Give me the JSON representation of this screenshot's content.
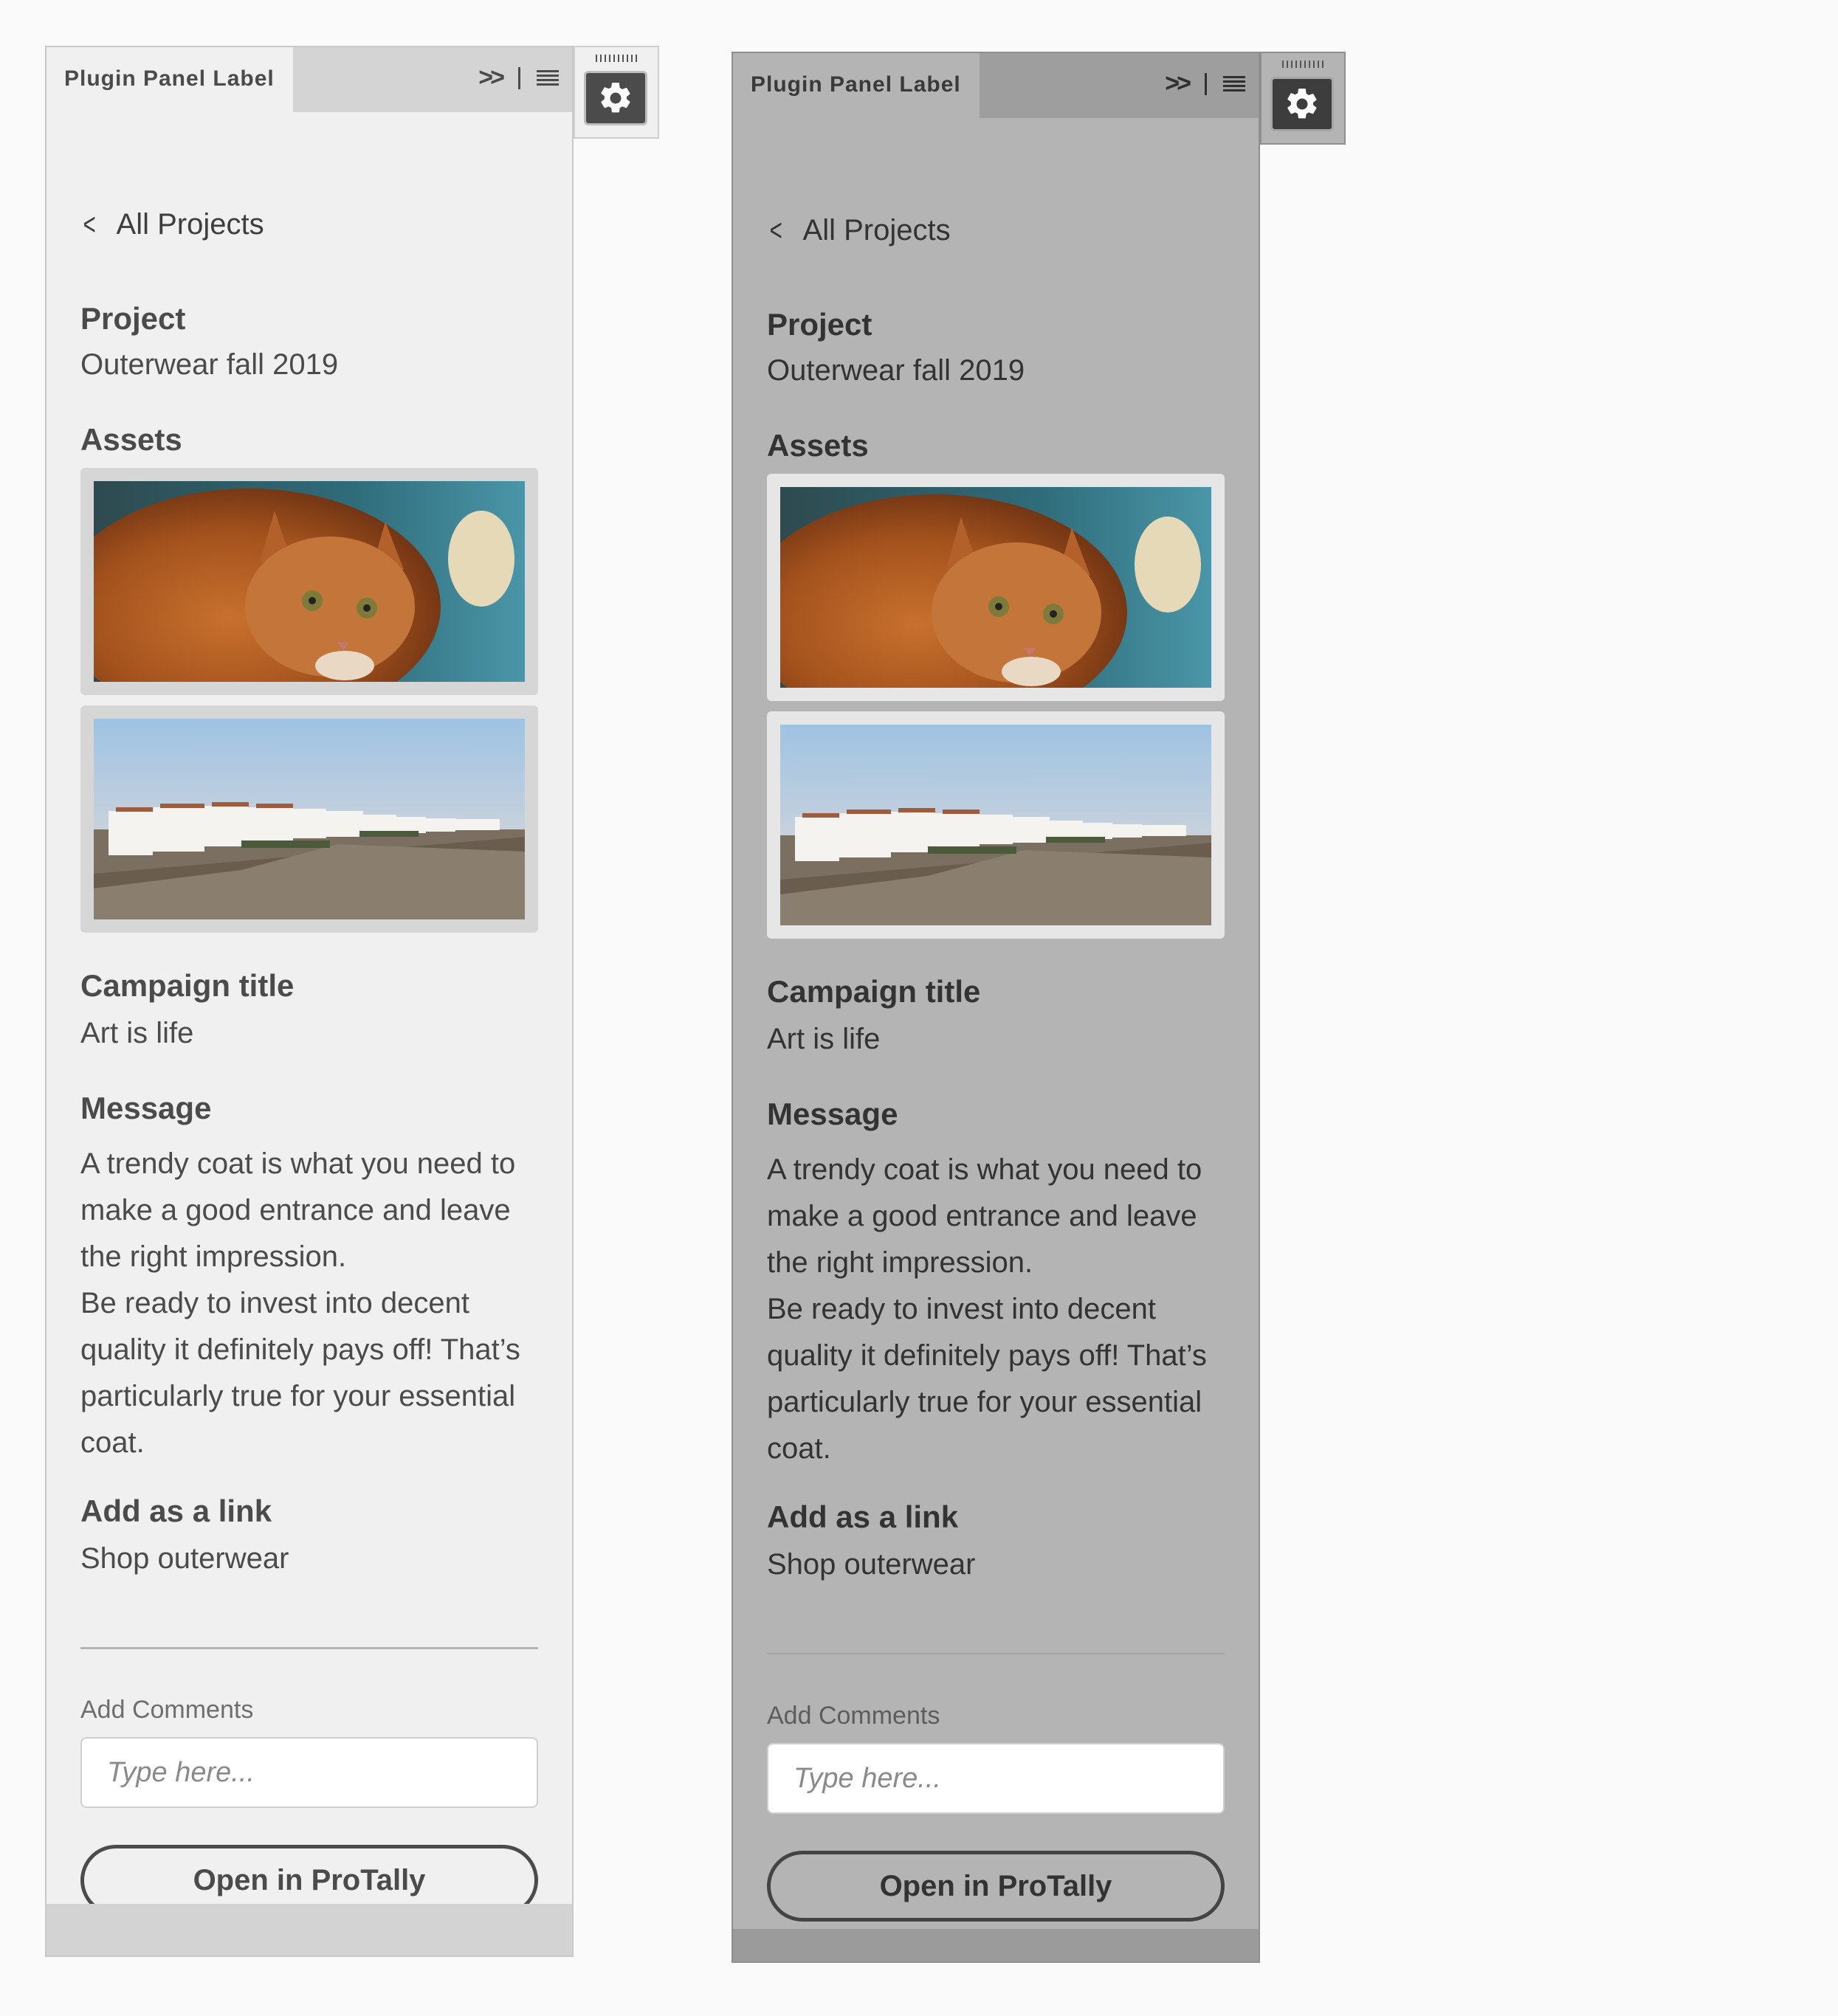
{
  "panel_label": "Plugin Panel Label",
  "back_label": "All Projects",
  "project": {
    "label": "Project",
    "value": "Outerwear fall 2019"
  },
  "assets_label": "Assets",
  "campaign": {
    "label": "Campaign title",
    "value": "Art is life"
  },
  "message": {
    "label": "Message",
    "paragraph1": "A trendy coat is what you need to make a good entrance and leave the right impression.",
    "paragraph2": "Be ready to invest into decent quality it definitely pays off! That’s particularly true for your essential coat."
  },
  "link": {
    "label": "Add as a link",
    "value": "Shop outerwear"
  },
  "comments": {
    "label": "Add Comments",
    "placeholder": "Type here...",
    "value": ""
  },
  "open_button": "Open in ProTally",
  "icons": {
    "collapse": "double-chevron-right-icon",
    "menu": "hamburger-menu-icon",
    "back": "chevron-left-icon",
    "settings": "gear-icon"
  },
  "assets": [
    {
      "name": "orange-cat-photo"
    },
    {
      "name": "white-village-landscape-photo"
    }
  ]
}
